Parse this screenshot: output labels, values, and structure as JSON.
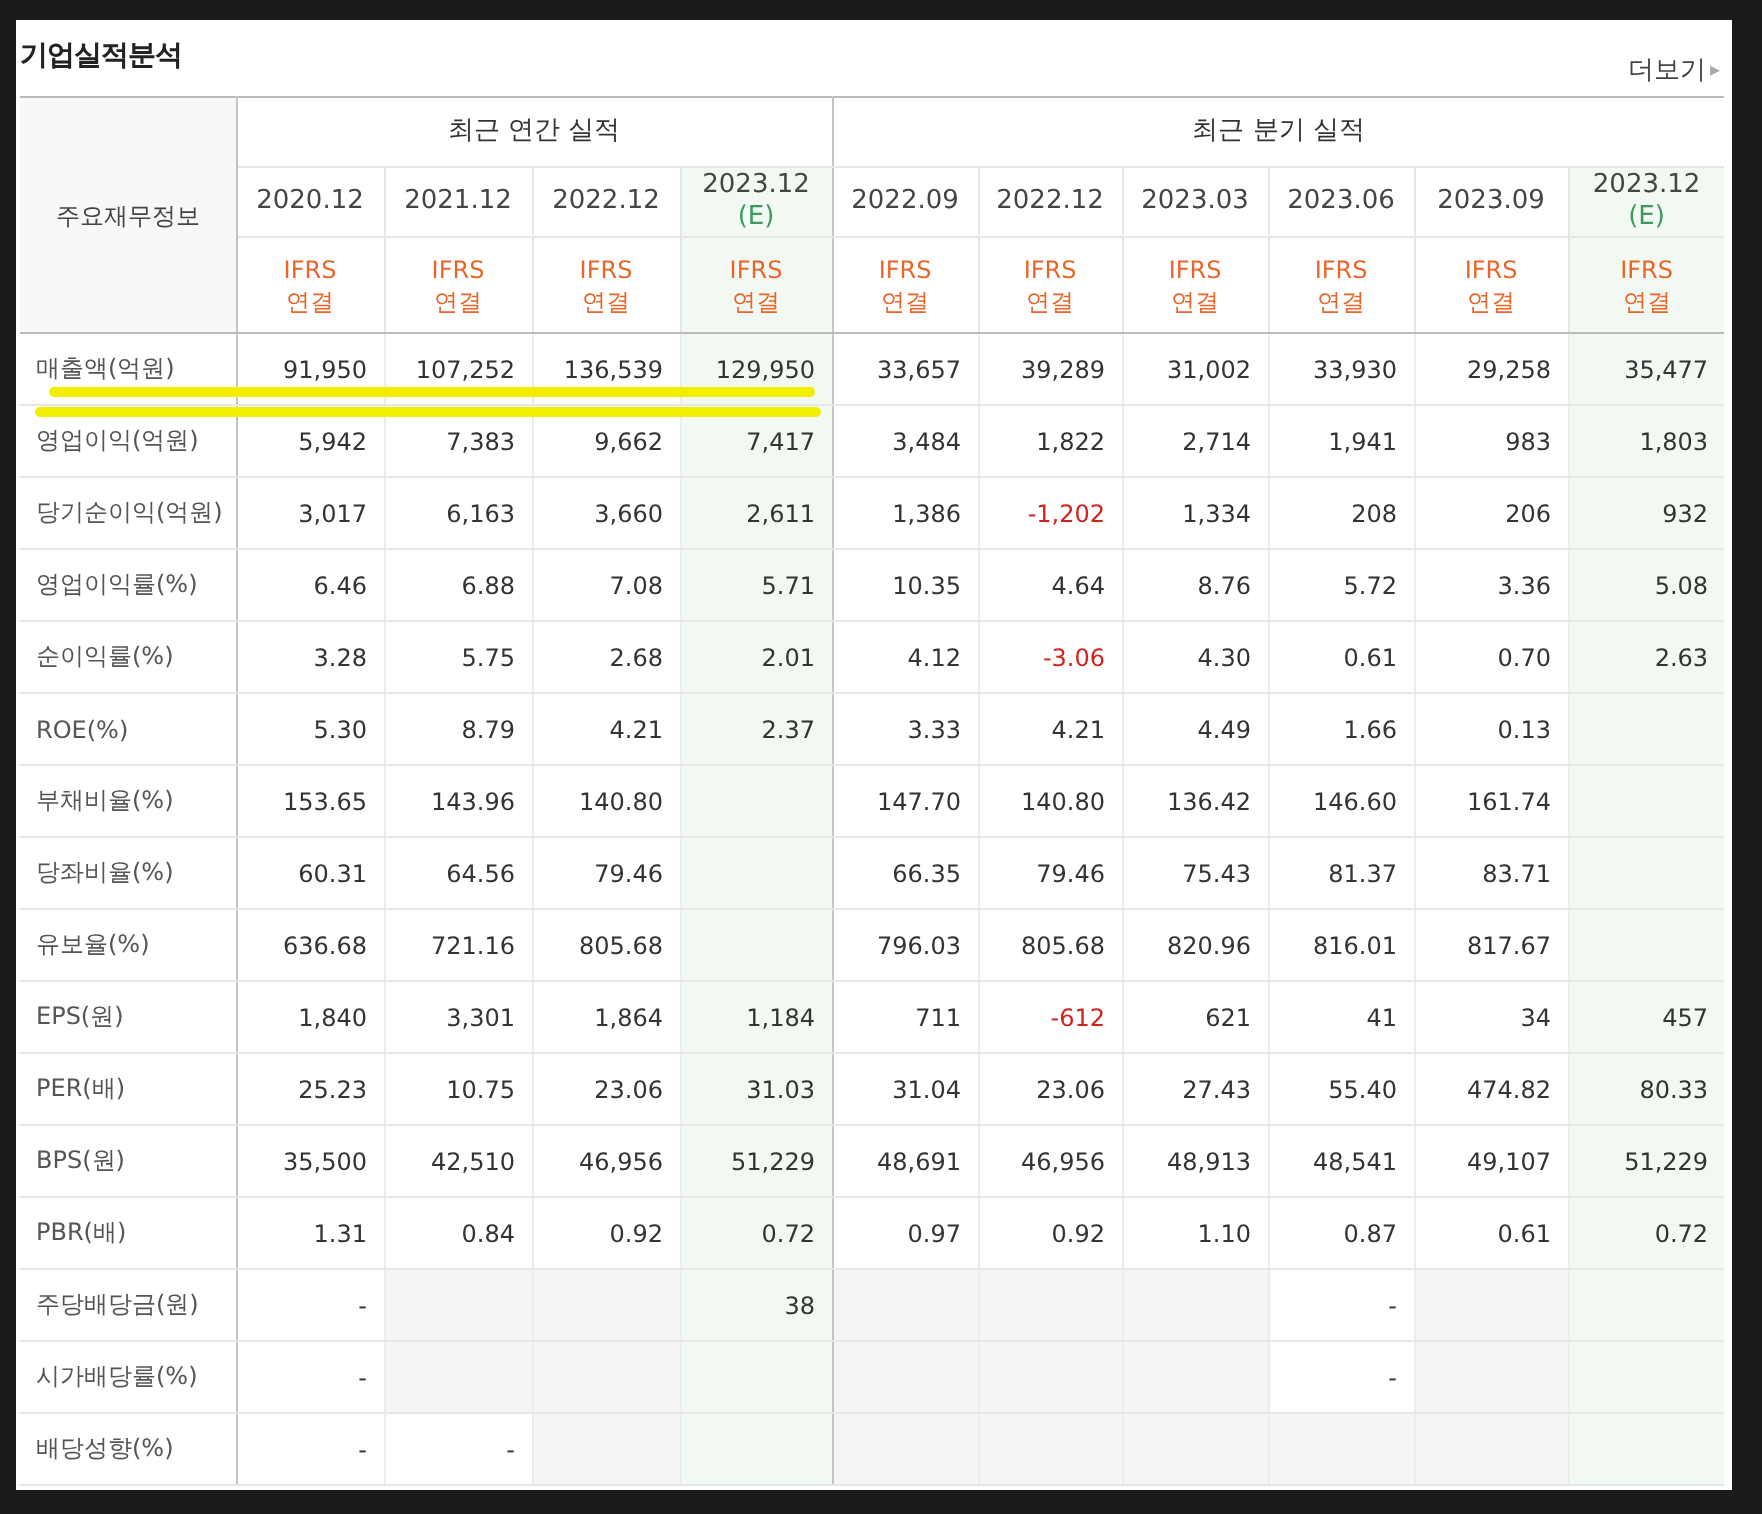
{
  "title": "기업실적분석",
  "more_link": {
    "label": "더보기",
    "arrow": "▸"
  },
  "corner_label": "주요재무정보",
  "column_groups": [
    {
      "title": "최근 연간 실적",
      "columns": [
        {
          "period": "2020.12",
          "basis": [
            "IFRS",
            "연결"
          ],
          "estimate": false
        },
        {
          "period": "2021.12",
          "basis": [
            "IFRS",
            "연결"
          ],
          "estimate": false
        },
        {
          "period": "2022.12",
          "basis": [
            "IFRS",
            "연결"
          ],
          "estimate": false
        },
        {
          "period": "2023.12",
          "note": "(E)",
          "basis": [
            "IFRS",
            "연결"
          ],
          "estimate": true
        }
      ]
    },
    {
      "title": "최근 분기 실적",
      "columns": [
        {
          "period": "2022.09",
          "basis": [
            "IFRS",
            "연결"
          ],
          "estimate": false
        },
        {
          "period": "2022.12",
          "basis": [
            "IFRS",
            "연결"
          ],
          "estimate": false
        },
        {
          "period": "2023.03",
          "basis": [
            "IFRS",
            "연결"
          ],
          "estimate": false
        },
        {
          "period": "2023.06",
          "basis": [
            "IFRS",
            "연결"
          ],
          "estimate": false
        },
        {
          "period": "2023.09",
          "basis": [
            "IFRS",
            "연결"
          ],
          "estimate": false
        },
        {
          "period": "2023.12",
          "note": "(E)",
          "basis": [
            "IFRS",
            "연결"
          ],
          "estimate": true
        }
      ]
    }
  ],
  "sections": [
    {
      "rows": [
        {
          "label": "매출액(억원)",
          "highlighted": true,
          "values": [
            "91,950",
            "107,252",
            "136,539",
            "129,950",
            "33,657",
            "39,289",
            "31,002",
            "33,930",
            "29,258",
            "35,477"
          ]
        },
        {
          "label": "영업이익(억원)",
          "highlighted": true,
          "values": [
            "5,942",
            "7,383",
            "9,662",
            "7,417",
            "3,484",
            "1,822",
            "2,714",
            "1,941",
            "983",
            "1,803"
          ]
        },
        {
          "label": "당기순이익(억원)",
          "highlighted": false,
          "values": [
            "3,017",
            "6,163",
            "3,660",
            "2,611",
            "1,386",
            {
              "text": "-1,202",
              "negative": true
            },
            "1,334",
            "208",
            "206",
            "932"
          ]
        }
      ]
    },
    {
      "rows": [
        {
          "label": "영업이익률(%)",
          "highlighted": false,
          "values": [
            "6.46",
            "6.88",
            "7.08",
            "5.71",
            "10.35",
            "4.64",
            "8.76",
            "5.72",
            "3.36",
            "5.08"
          ]
        },
        {
          "label": "순이익률(%)",
          "highlighted": false,
          "values": [
            "3.28",
            "5.75",
            "2.68",
            "2.01",
            "4.12",
            {
              "text": "-3.06",
              "negative": true
            },
            "4.30",
            "0.61",
            "0.70",
            "2.63"
          ]
        },
        {
          "label": "ROE(%)",
          "highlighted": false,
          "values": [
            "5.30",
            "8.79",
            "4.21",
            "2.37",
            "3.33",
            "4.21",
            "4.49",
            "1.66",
            "0.13",
            {
              "kind": "blank"
            }
          ]
        }
      ]
    },
    {
      "rows": [
        {
          "label": "부채비율(%)",
          "highlighted": false,
          "values": [
            "153.65",
            "143.96",
            "140.80",
            {
              "kind": "blank"
            },
            "147.70",
            "140.80",
            "136.42",
            "146.60",
            "161.74",
            {
              "kind": "blank"
            }
          ]
        },
        {
          "label": "당좌비율(%)",
          "highlighted": false,
          "values": [
            "60.31",
            "64.56",
            "79.46",
            {
              "kind": "blank"
            },
            "66.35",
            "79.46",
            "75.43",
            "81.37",
            "83.71",
            {
              "kind": "blank"
            }
          ]
        },
        {
          "label": "유보율(%)",
          "highlighted": false,
          "values": [
            "636.68",
            "721.16",
            "805.68",
            {
              "kind": "blank"
            },
            "796.03",
            "805.68",
            "820.96",
            "816.01",
            "817.67",
            {
              "kind": "blank"
            }
          ]
        }
      ]
    },
    {
      "rows": [
        {
          "label": "EPS(원)",
          "highlighted": false,
          "values": [
            "1,840",
            "3,301",
            "1,864",
            "1,184",
            "711",
            {
              "text": "-612",
              "negative": true
            },
            "621",
            "41",
            "34",
            "457"
          ]
        },
        {
          "label": "PER(배)",
          "highlighted": false,
          "values": [
            "25.23",
            "10.75",
            "23.06",
            "31.03",
            "31.04",
            "23.06",
            "27.43",
            "55.40",
            "474.82",
            "80.33"
          ]
        },
        {
          "label": "BPS(원)",
          "highlighted": false,
          "values": [
            "35,500",
            "42,510",
            "46,956",
            "51,229",
            "48,691",
            "46,956",
            "48,913",
            "48,541",
            "49,107",
            "51,229"
          ]
        },
        {
          "label": "PBR(배)",
          "highlighted": false,
          "values": [
            "1.31",
            "0.84",
            "0.92",
            "0.72",
            "0.97",
            "0.92",
            "1.10",
            "0.87",
            "0.61",
            "0.72"
          ]
        }
      ]
    },
    {
      "rows": [
        {
          "label": "주당배당금(원)",
          "highlighted": false,
          "values": [
            "-",
            {
              "kind": "blank"
            },
            {
              "kind": "blank"
            },
            "38",
            {
              "kind": "blank"
            },
            {
              "kind": "blank"
            },
            {
              "kind": "blank"
            },
            "-",
            {
              "kind": "blank"
            },
            {
              "kind": "blank"
            }
          ]
        },
        {
          "label": "시가배당률(%)",
          "highlighted": false,
          "values": [
            "-",
            {
              "kind": "blank"
            },
            {
              "kind": "blank"
            },
            {
              "kind": "blank"
            },
            {
              "kind": "blank"
            },
            {
              "kind": "blank"
            },
            {
              "kind": "blank"
            },
            "-",
            {
              "kind": "blank"
            },
            {
              "kind": "blank"
            }
          ]
        },
        {
          "label": "배당성향(%)",
          "highlighted": false,
          "values": [
            "-",
            "-",
            {
              "kind": "blank"
            },
            {
              "kind": "blank"
            },
            {
              "kind": "blank"
            },
            {
              "kind": "blank"
            },
            {
              "kind": "blank"
            },
            {
              "kind": "blank"
            },
            {
              "kind": "blank"
            },
            {
              "kind": "blank"
            }
          ]
        }
      ]
    }
  ]
}
